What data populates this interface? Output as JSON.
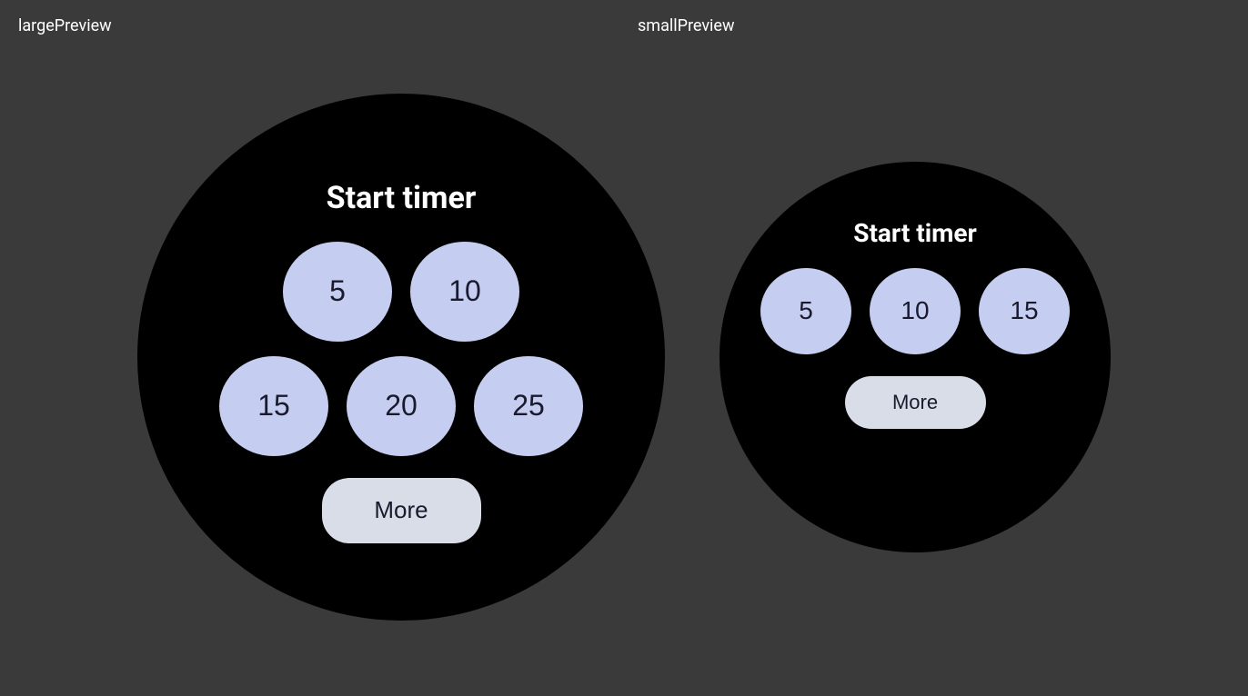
{
  "labels": {
    "large": "largePreview",
    "small": "smallPreview"
  },
  "large_watch": {
    "title": "Start timer",
    "row1": [
      "5",
      "10"
    ],
    "row2": [
      "15",
      "20",
      "25"
    ],
    "more_label": "More"
  },
  "small_watch": {
    "title": "Start timer",
    "row1": [
      "5",
      "10",
      "15"
    ],
    "more_label": "More"
  }
}
